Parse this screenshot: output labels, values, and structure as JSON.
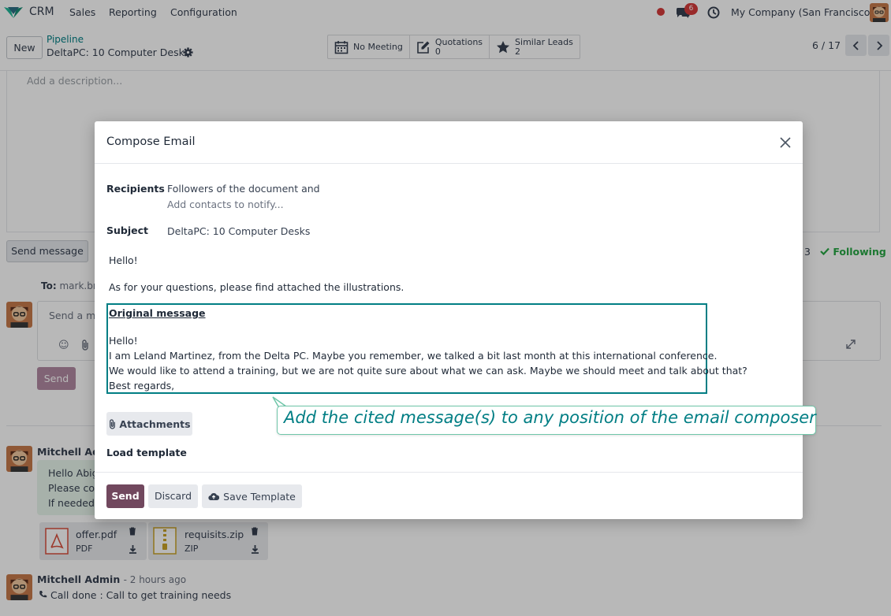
{
  "navbar": {
    "app_name": "CRM",
    "menu": [
      "Sales",
      "Reporting",
      "Configuration"
    ],
    "message_badge": "6",
    "company": "My Company (San Francisco)"
  },
  "control_panel": {
    "new_label": "New",
    "breadcrumb_parent": "Pipeline",
    "breadcrumb_current": "DeltaPC: 10 Computer Desks",
    "smart_buttons": [
      {
        "label": "No Meeting",
        "value": ""
      },
      {
        "label": "Quotations",
        "value": "0"
      },
      {
        "label": "Similar Leads",
        "value": "2"
      }
    ],
    "pager": "6 / 17"
  },
  "form": {
    "description_placeholder": "Add a description...",
    "send_message_label": "Send message",
    "followers_count": "3",
    "following_label": "Following",
    "to_label": "To:",
    "to_value": "mark.bro",
    "composer_placeholder": "Send a me",
    "send_label": "Send"
  },
  "chatter": {
    "messages": [
      {
        "author": "Mitchell Adr",
        "lines": [
          "Hello Abig",
          "Please cor",
          "If needed,"
        ],
        "attachments": [
          {
            "name": "offer.pdf",
            "type": "PDF"
          },
          {
            "name": "requisits.zip",
            "type": "ZIP"
          }
        ]
      },
      {
        "author": "Mitchell Admin",
        "time": "- 2 hours ago",
        "activity": "Call done : Call to get training needs"
      }
    ]
  },
  "modal": {
    "title": "Compose Email",
    "recipients_label": "Recipients",
    "recipients_value": "Followers of the document and",
    "recipients_placeholder": "Add contacts to notify...",
    "subject_label": "Subject",
    "subject_value": "DeltaPC: 10 Computer Desks",
    "body_lines": [
      "Hello!",
      "As for your questions, please find attached the illustrations."
    ],
    "cited": {
      "title": "Original message",
      "lines": [
        "Hello!",
        "I am Leland Martinez, from the Delta PC. Maybe you remember, we talked a bit last month at this international conference.",
        "We would like to attend a training, but we are not quite sure about what we can ask. Maybe we should meet and talk about that?",
        "Best regards,"
      ]
    },
    "attachments_label": "Attachments",
    "load_template_label": "Load template",
    "send_label": "Send",
    "discard_label": "Discard",
    "save_template_label": "Save Template"
  },
  "callout": {
    "text": "Add the cited message(s) to any position of the email composer"
  },
  "colors": {
    "brand_purple": "#71485e",
    "teal": "#017e84",
    "following_green": "#28a745",
    "badge_red": "#d43b3b",
    "callout_border": "#6fc6a9"
  }
}
